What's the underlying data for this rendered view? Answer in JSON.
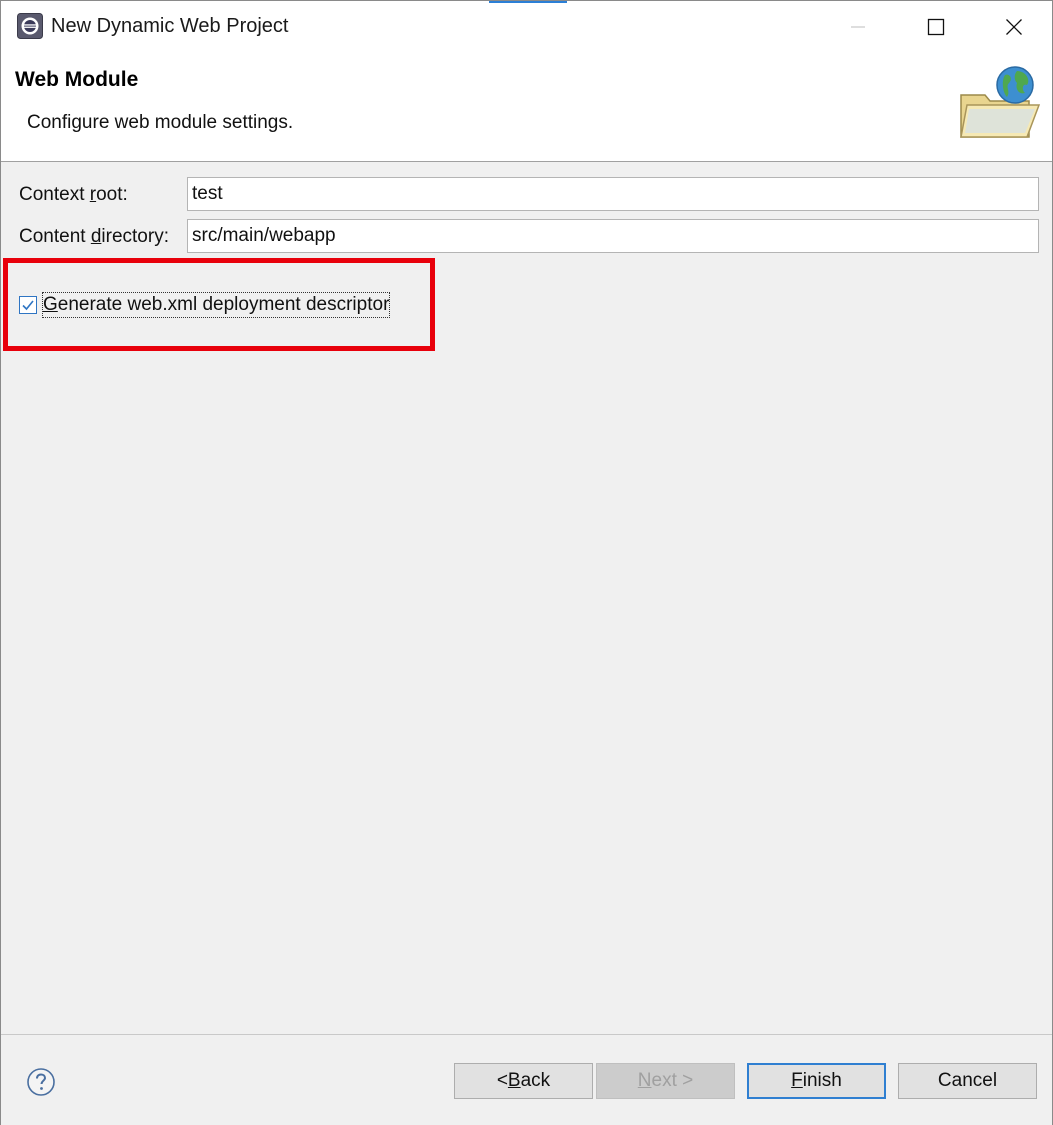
{
  "window": {
    "title": "New Dynamic Web Project",
    "controls": {
      "minimize_icon": "minimize-icon",
      "maximize_icon": "maximize-icon",
      "close_icon": "close-icon"
    }
  },
  "banner": {
    "title": "Web Module",
    "description": "Configure web module settings.",
    "icon": "web-folder-globe-icon"
  },
  "form": {
    "context_root": {
      "label_pre": "Context ",
      "label_mnemonic": "r",
      "label_post": "oot:",
      "value": "test"
    },
    "content_directory": {
      "label_pre": "Content ",
      "label_mnemonic": "d",
      "label_post": "irectory:",
      "value": "src/main/webapp"
    },
    "generate_web_xml": {
      "checked": true,
      "label_mnemonic": "G",
      "label_post": "enerate web.xml deployment descriptor"
    }
  },
  "highlight_color": "#e8000b",
  "footer": {
    "help_icon": "help-icon",
    "buttons": {
      "back": {
        "pre": "< ",
        "mnemonic": "B",
        "post": "ack"
      },
      "next": {
        "mnemonic": "N",
        "post": "ext >",
        "enabled": false
      },
      "finish": {
        "mnemonic": "F",
        "post": "inish"
      },
      "cancel": {
        "label": "Cancel"
      }
    }
  }
}
